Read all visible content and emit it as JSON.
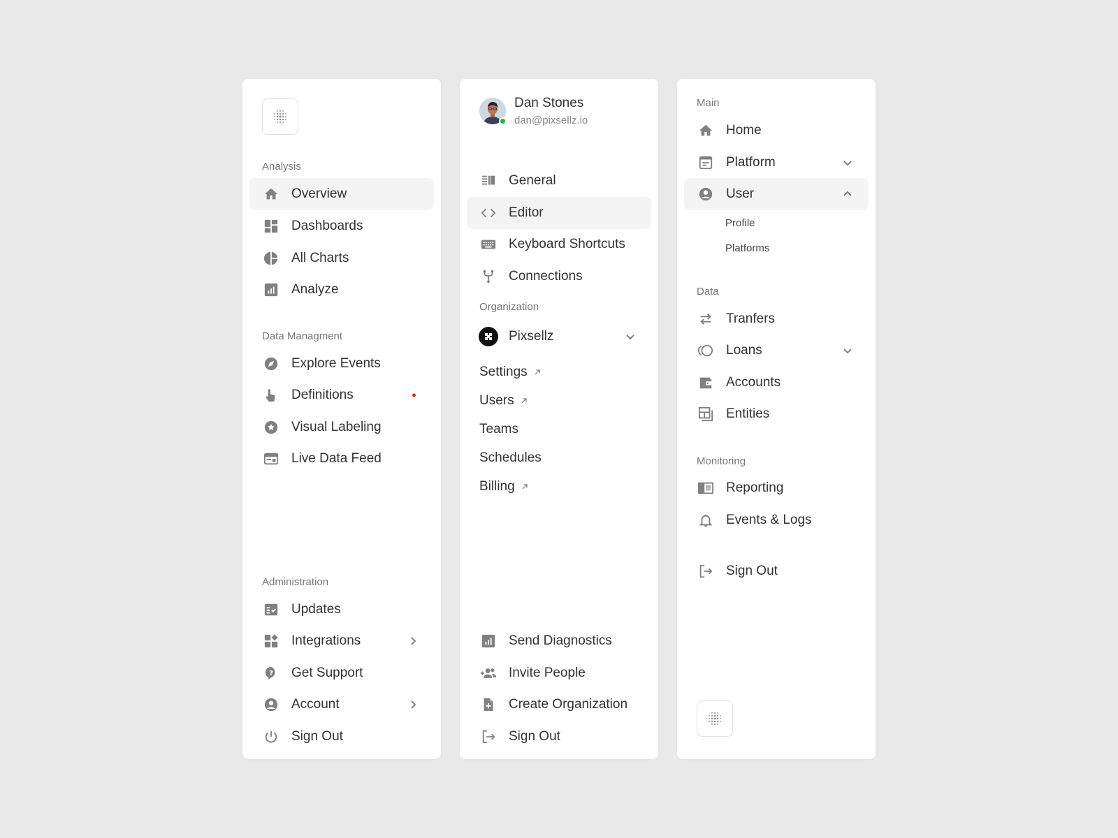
{
  "panel1": {
    "sections": {
      "analysis": "Analysis",
      "data_management": "Data Managment",
      "administration": "Administration"
    },
    "items": {
      "overview": "Overview",
      "dashboards": "Dashboards",
      "all_charts": "All Charts",
      "analyze": "Analyze",
      "explore_events": "Explore Events",
      "definitions": "Definitions",
      "visual_labeling": "Visual Labeling",
      "live_data_feed": "Live Data Feed",
      "updates": "Updates",
      "integrations": "Integrations",
      "get_support": "Get Support",
      "account": "Account",
      "sign_out": "Sign Out"
    },
    "active_item": "Overview"
  },
  "panel2": {
    "user": {
      "name": "Dan Stones",
      "email": "dan@pixsellz.io",
      "status": "online"
    },
    "items": {
      "general": "General",
      "editor": "Editor",
      "keyboard_shortcuts": "Keyboard Shortcuts",
      "connections": "Connections"
    },
    "active_item": "Editor",
    "organization_label": "Organization",
    "organization_name": "Pixsellz",
    "org_links": {
      "settings": "Settings",
      "users": "Users",
      "teams": "Teams",
      "schedules": "Schedules",
      "billing": "Billing"
    },
    "bottom": {
      "send_diagnostics": "Send Diagnostics",
      "invite_people": "Invite People",
      "create_organization": "Create Organization",
      "sign_out": "Sign Out"
    }
  },
  "panel3": {
    "sections": {
      "main": "Main",
      "data": "Data",
      "monitoring": "Monitoring"
    },
    "items": {
      "home": "Home",
      "platform": "Platform",
      "user": "User",
      "profile": "Profile",
      "platforms": "Platforms",
      "transfers": "Tranfers",
      "loans": "Loans",
      "accounts": "Accounts",
      "entities": "Entities",
      "reporting": "Reporting",
      "events_logs": "Events & Logs",
      "sign_out": "Sign Out"
    },
    "active_item": "User"
  },
  "colors": {
    "background": "#e9e9e9",
    "panel": "#ffffff",
    "icon": "#808080",
    "active_bg": "#f4f4f4",
    "text": "#333333",
    "muted": "#777777",
    "notification": "#e02020",
    "online": "#22b34a"
  }
}
